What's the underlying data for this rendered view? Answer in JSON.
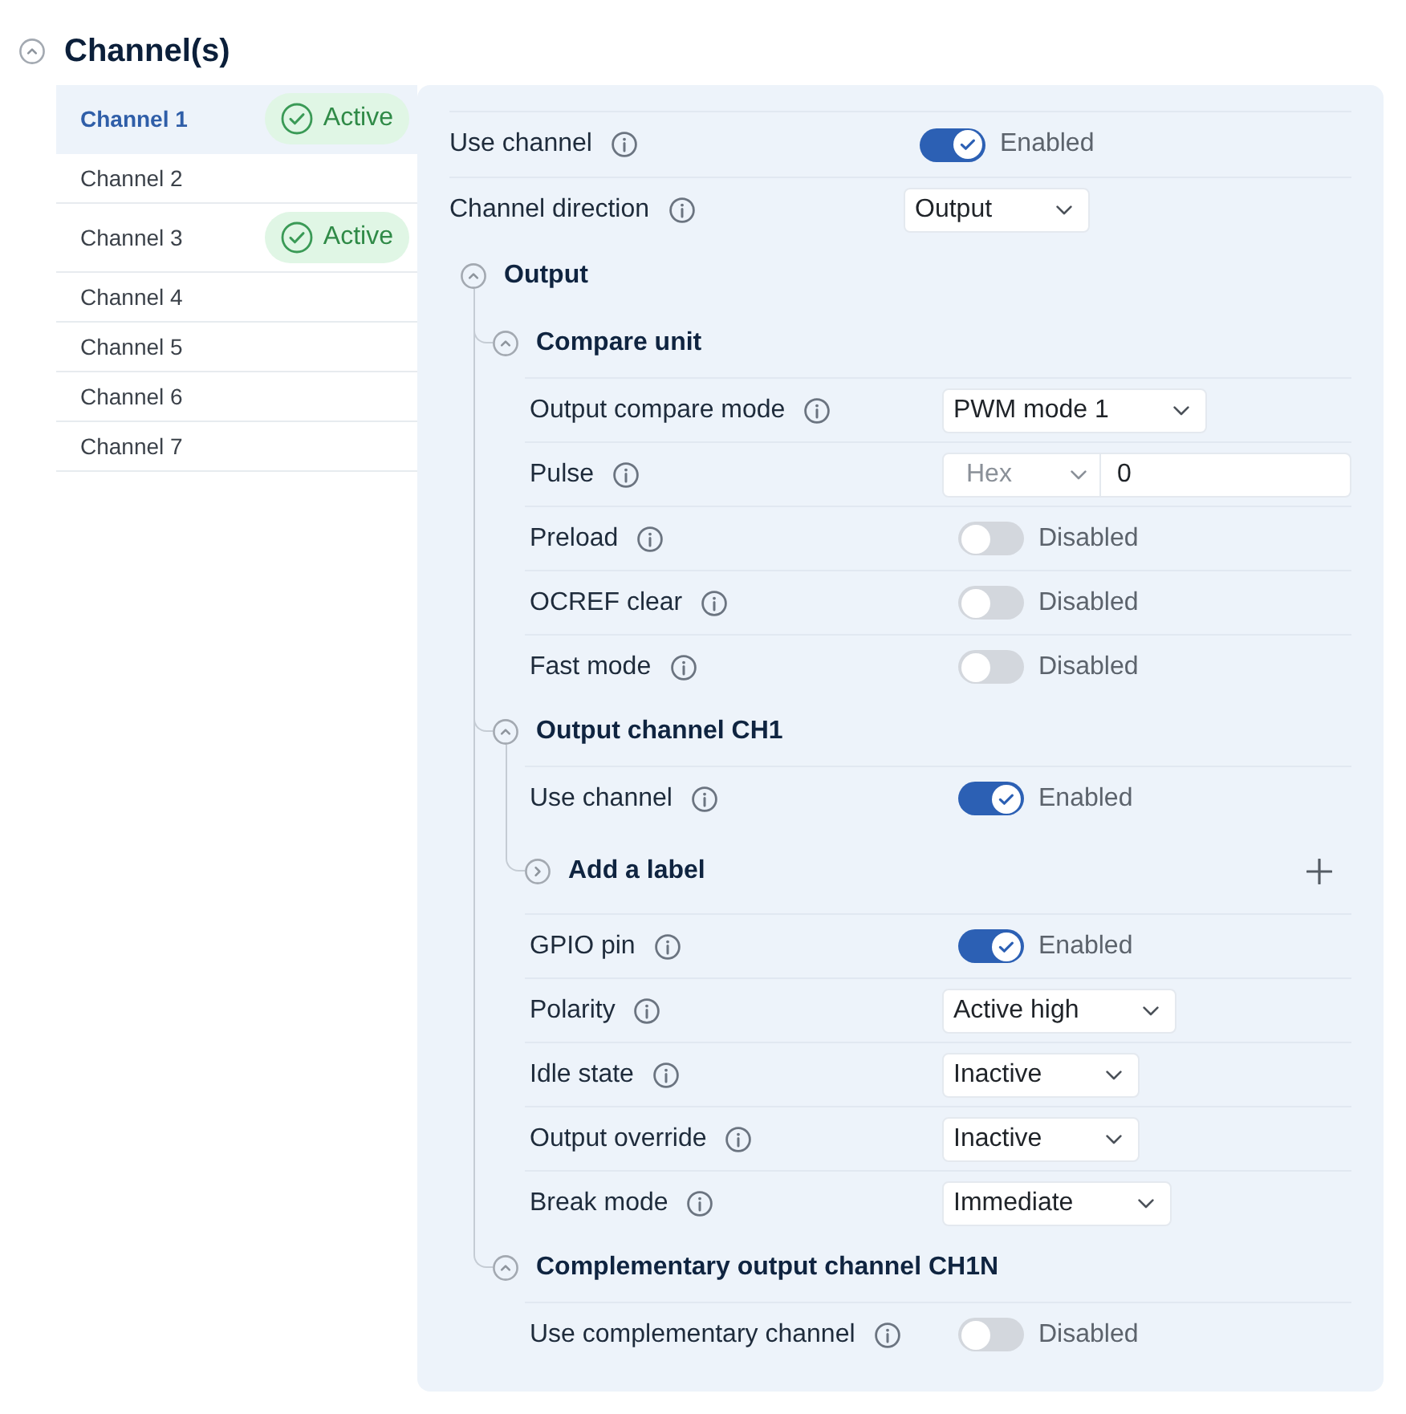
{
  "section": {
    "title": "Channel(s)",
    "expanded": true
  },
  "channels": [
    {
      "label": "Channel 1",
      "selected": true,
      "badge": "Active"
    },
    {
      "label": "Channel 2",
      "selected": false
    },
    {
      "label": "Channel 3",
      "selected": false,
      "badge": "Active"
    },
    {
      "label": "Channel 4",
      "selected": false
    },
    {
      "label": "Channel 5",
      "selected": false
    },
    {
      "label": "Channel 6",
      "selected": false
    },
    {
      "label": "Channel 7",
      "selected": false
    }
  ],
  "settings": [
    {
      "kind": "toggle",
      "label": "Use channel",
      "on": true,
      "status": "Enabled"
    },
    {
      "kind": "select",
      "label": "Channel direction",
      "value": "Output"
    },
    {
      "kind": "group",
      "title": "Output",
      "expanded": true,
      "children": [
        {
          "kind": "group",
          "title": "Compare unit",
          "expanded": true,
          "children": [
            {
              "kind": "select",
              "label": "Output compare mode",
              "value": "PWM mode 1"
            },
            {
              "kind": "number",
              "label": "Pulse",
              "format": "Hex",
              "value": "0"
            },
            {
              "kind": "toggle",
              "label": "Preload",
              "on": false,
              "status": "Disabled"
            },
            {
              "kind": "toggle",
              "label": "OCREF clear",
              "on": false,
              "status": "Disabled"
            },
            {
              "kind": "toggle",
              "label": "Fast mode",
              "on": false,
              "status": "Disabled"
            }
          ]
        },
        {
          "kind": "group",
          "title": "Output channel CH1",
          "expanded": true,
          "children": [
            {
              "kind": "toggle",
              "label": "Use channel",
              "on": true,
              "status": "Enabled"
            },
            {
              "kind": "group",
              "title": "Add a label",
              "expanded": false,
              "addable": true
            },
            {
              "kind": "toggle",
              "label": "GPIO pin",
              "on": true,
              "status": "Enabled"
            },
            {
              "kind": "select",
              "label": "Polarity",
              "value": "Active high"
            },
            {
              "kind": "select",
              "label": "Idle state",
              "value": "Inactive"
            },
            {
              "kind": "select",
              "label": "Output override",
              "value": "Inactive"
            },
            {
              "kind": "select",
              "label": "Break mode",
              "value": "Immediate"
            }
          ]
        },
        {
          "kind": "group",
          "title": "Complementary output channel CH1N",
          "expanded": true,
          "children": [
            {
              "kind": "toggle",
              "label": "Use complementary channel",
              "on": false,
              "status": "Disabled"
            }
          ]
        }
      ]
    }
  ]
}
